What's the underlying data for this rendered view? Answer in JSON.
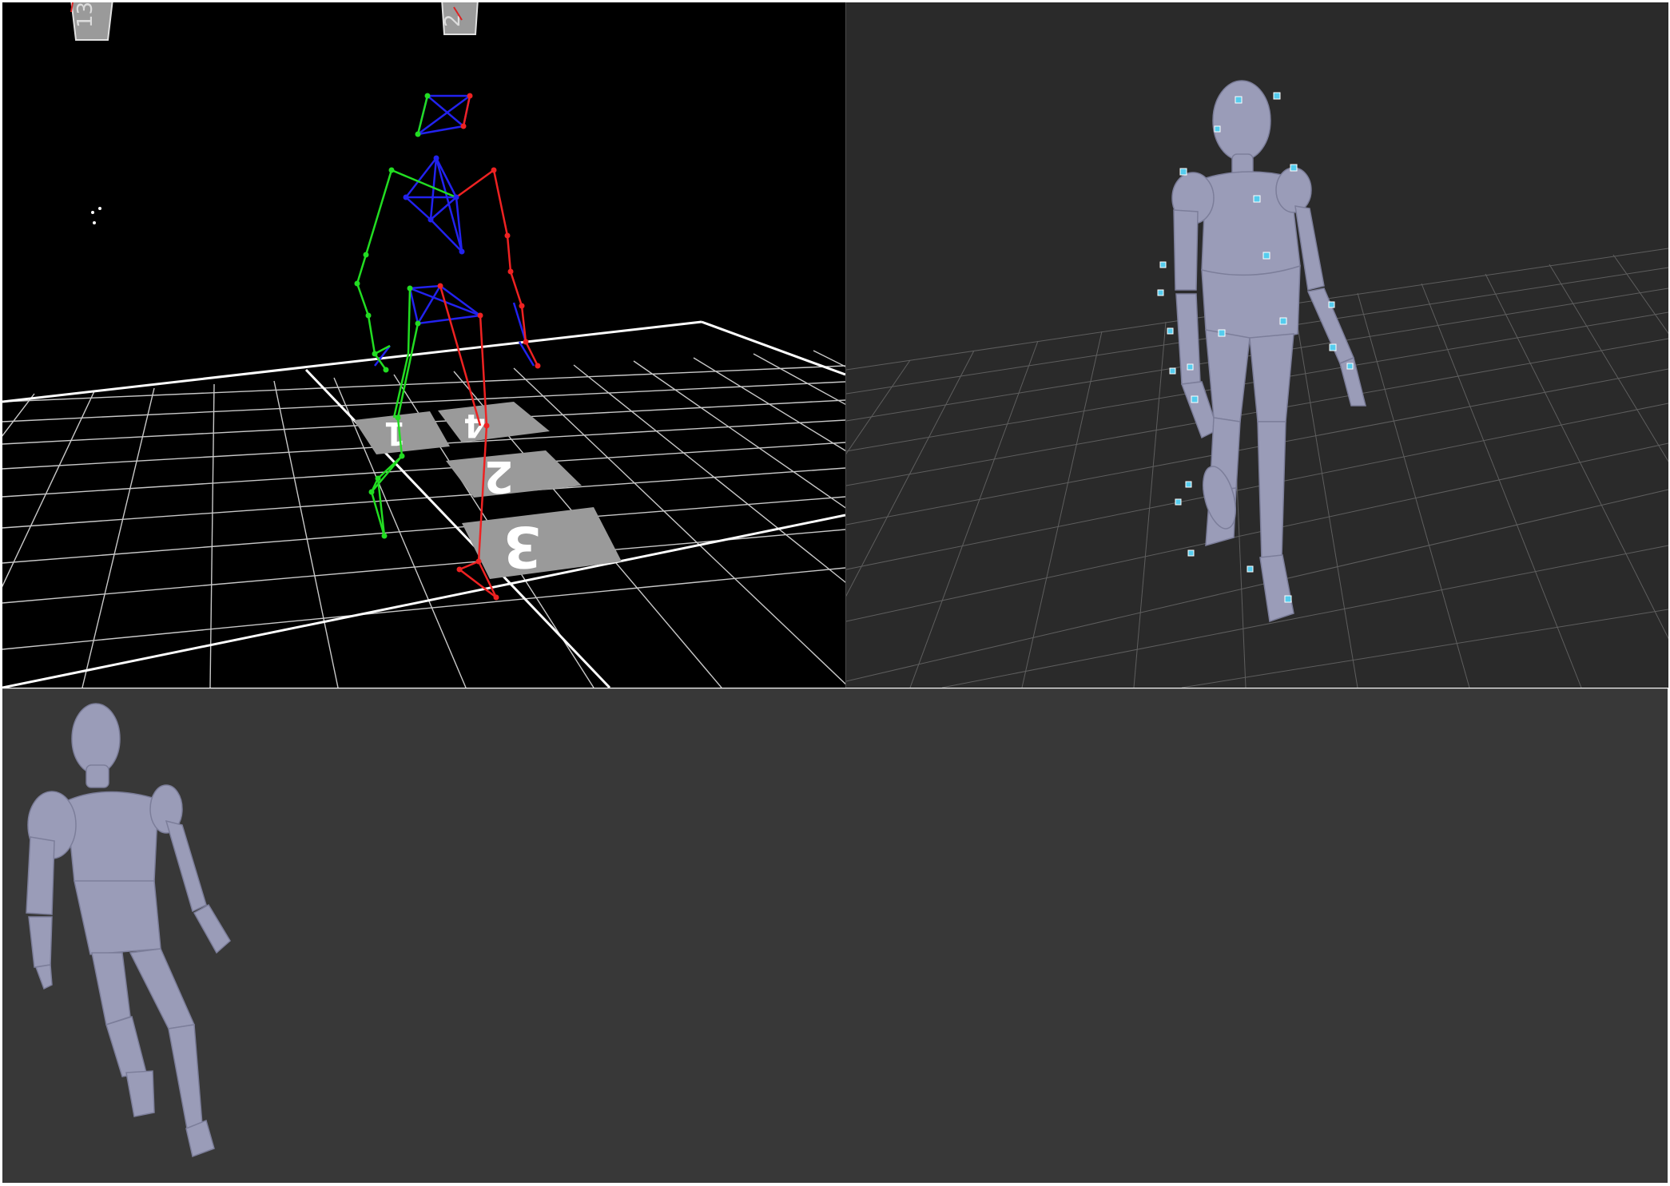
{
  "viewports": {
    "skeleton": {
      "camera_labels": [
        "13",
        "2"
      ],
      "floor_markers": [
        "1",
        "4",
        "2",
        "3"
      ]
    },
    "avatar": {
      "grid_labels": [
        "",
        "",
        "",
        ""
      ]
    },
    "preview": {}
  },
  "colors": {
    "left_chain": "#22dd22",
    "right_chain": "#ee2222",
    "center_chain": "#2222ee",
    "marker": "#55ccee",
    "avatar_body": "#9a9cb8",
    "skeleton_bg": "#000000",
    "avatar_bg": "#2a2a2a",
    "preview_bg": "#383838"
  }
}
